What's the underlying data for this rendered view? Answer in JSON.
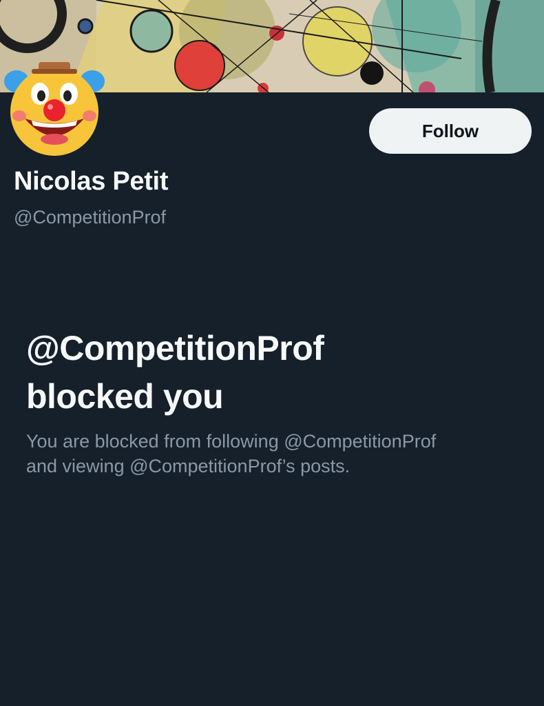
{
  "profile": {
    "display_name": "Nicolas Petit",
    "handle": "@CompetitionProf",
    "avatar_icon": "clown-face-emoji",
    "banner_image": "abstract-circles-painting"
  },
  "actions": {
    "follow_label": "Follow"
  },
  "blocked_notice": {
    "title_line1": "@CompetitionProf",
    "title_line2": "blocked you",
    "body_line1": "You are blocked from following @CompetitionProf",
    "body_line2": "and viewing @CompetitionProf’s posts."
  },
  "colors": {
    "background": "#15202b",
    "primary_text": "#f7f9f9",
    "secondary_text": "#8b98a5",
    "follow_button_bg": "#eff3f4"
  }
}
